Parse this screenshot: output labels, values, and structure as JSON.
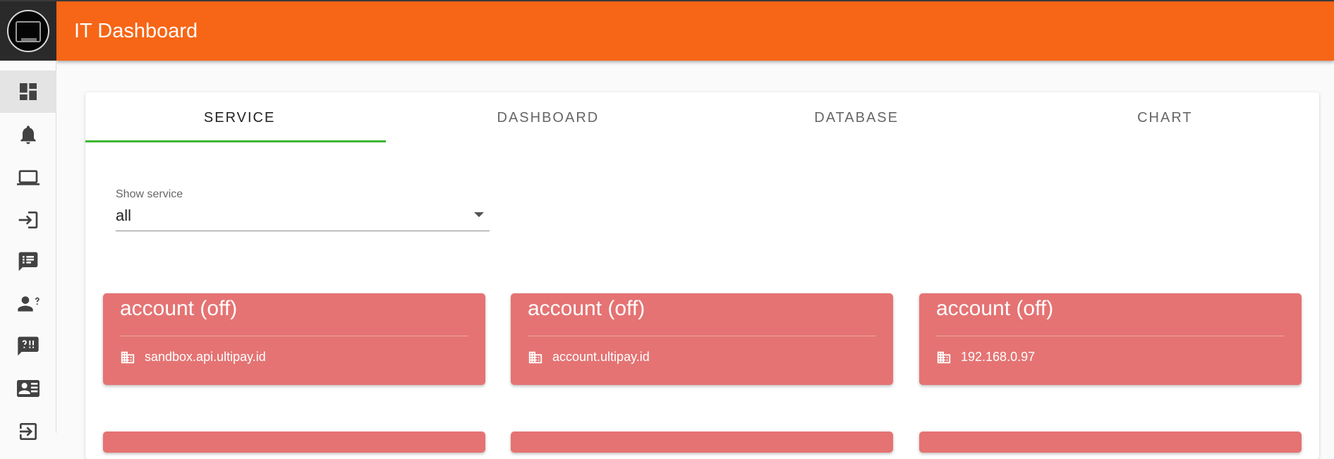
{
  "app": {
    "title": "IT Dashboard"
  },
  "sidebar": {
    "items": [
      {
        "icon": "dashboard-icon",
        "active": true
      },
      {
        "icon": "bell-icon",
        "active": false
      },
      {
        "icon": "laptop-icon",
        "active": false
      },
      {
        "icon": "login-icon",
        "active": false
      },
      {
        "icon": "list-message-icon",
        "active": false
      },
      {
        "icon": "user-question-icon",
        "active": false
      },
      {
        "icon": "question-chat-icon",
        "active": false
      },
      {
        "icon": "contact-card-icon",
        "active": false
      },
      {
        "icon": "logout-icon",
        "active": false
      }
    ]
  },
  "tabs": [
    {
      "label": "SERVICE",
      "active": true
    },
    {
      "label": "DASHBOARD",
      "active": false
    },
    {
      "label": "DATABASE",
      "active": false
    },
    {
      "label": "CHART",
      "active": false
    }
  ],
  "filter": {
    "label": "Show service",
    "value": "all"
  },
  "services": [
    {
      "title": "account (off)",
      "host": "sandbox.api.ultipay.id",
      "icon": "building-icon"
    },
    {
      "title": "account (off)",
      "host": "account.ultipay.id",
      "icon": "building-icon"
    },
    {
      "title": "account (off)",
      "host": "192.168.0.97",
      "icon": "building-icon"
    }
  ],
  "colors": {
    "topbar": "#f76516",
    "service_off": "#e57373",
    "tab_indicator": "#3cb833"
  }
}
